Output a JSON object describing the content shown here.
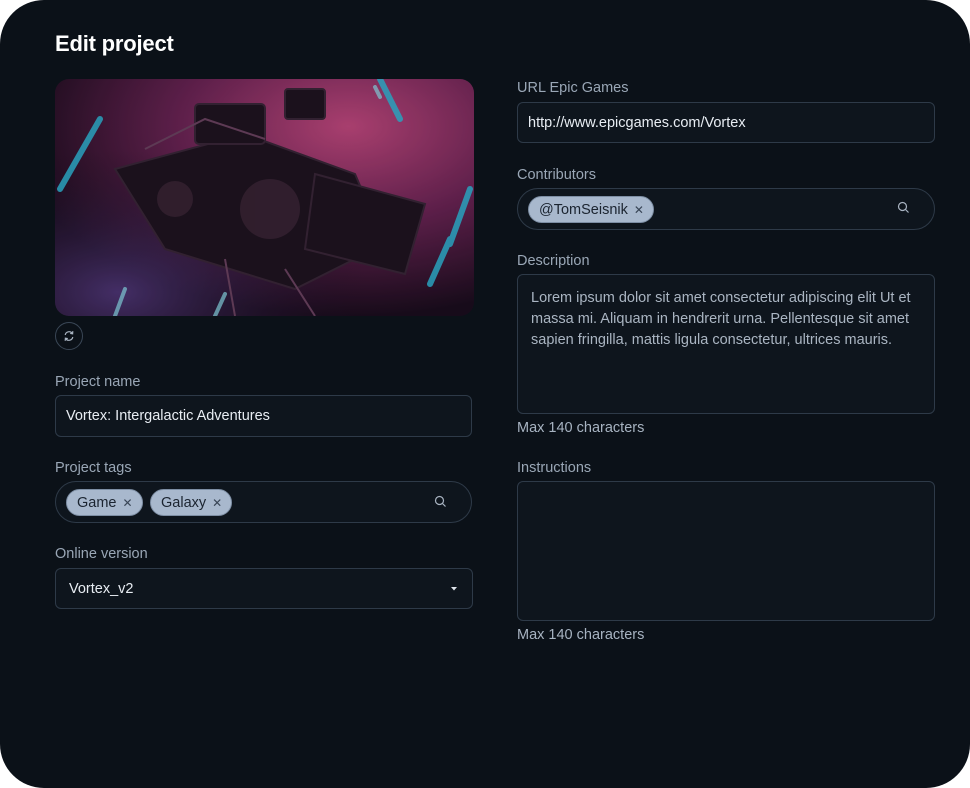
{
  "header": {
    "title": "Edit project"
  },
  "image": {
    "alt": "Film camera on stage with pink and blue lighting"
  },
  "project_name": {
    "label": "Project name",
    "value": "Vortex: Intergalactic Adventures"
  },
  "project_tags": {
    "label": "Project tags",
    "tags": [
      "Game",
      "Galaxy"
    ]
  },
  "online_version": {
    "label": "Online version",
    "selected": "Vortex_v2"
  },
  "url": {
    "label": "URL Epic Games",
    "value": "http://www.epicgames.com/Vortex"
  },
  "contributors": {
    "label": "Contributors",
    "tags": [
      "@TomSeisnik"
    ]
  },
  "description": {
    "label": "Description",
    "value": "Lorem ipsum dolor sit amet consectetur adipiscing elit Ut et massa mi. Aliquam in hendrerit urna. Pellentesque sit amet sapien fringilla, mattis ligula consectetur, ultrices mauris.",
    "hint": "Max 140 characters"
  },
  "instructions": {
    "label": "Instructions",
    "value": "",
    "hint": "Max 140 characters"
  },
  "icons": {
    "refresh": "refresh-icon",
    "search": "search-icon",
    "remove": "close-icon",
    "dropdown": "caret-down-icon"
  },
  "colors": {
    "background": "#0b1118",
    "field_border": "#2e3a48",
    "tag_fill": "#a8b8cd"
  }
}
